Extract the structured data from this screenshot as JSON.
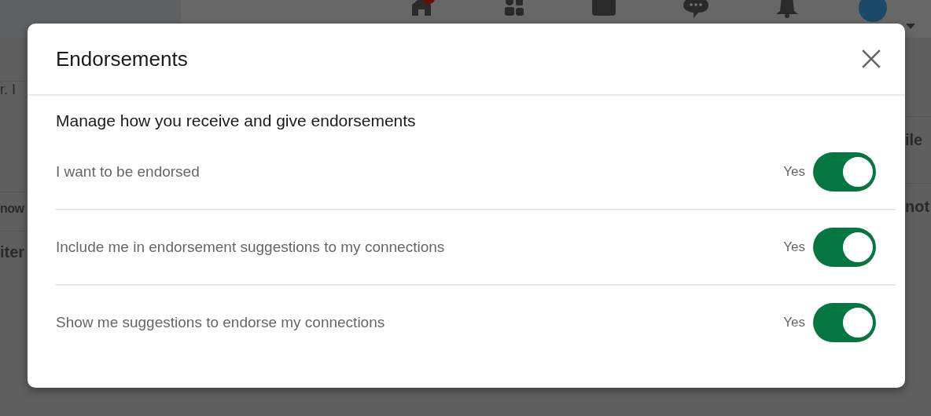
{
  "background": {
    "left_fragments": [
      "r. I",
      "now",
      "iter"
    ],
    "right_fragments": [
      "ile",
      "not"
    ]
  },
  "dialog": {
    "title": "Endorsements",
    "subtitle": "Manage how you receive and give endorsements",
    "settings": [
      {
        "label": "I want to be endorsed",
        "state_text": "Yes",
        "on": true
      },
      {
        "label": "Include me in endorsement suggestions to my connections",
        "state_text": "Yes",
        "on": true
      },
      {
        "label": "Show me suggestions to endorse my connections",
        "state_text": "Yes",
        "on": true
      }
    ]
  }
}
